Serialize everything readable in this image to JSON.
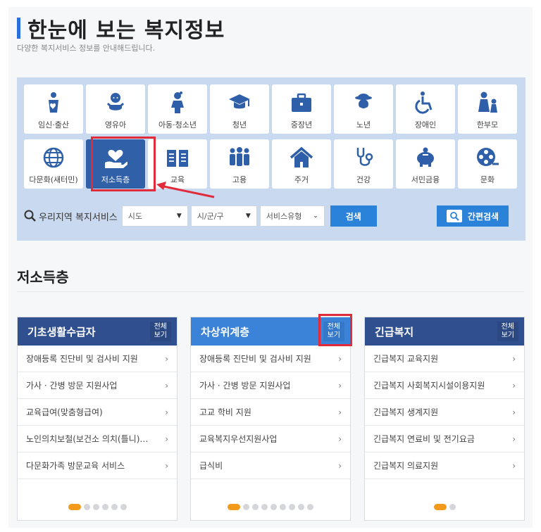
{
  "header": {
    "title": "한눈에 보는 복지정보",
    "subtitle": "다양한 복지서비스 정보를 안내해드립니다."
  },
  "categories": [
    {
      "label": "임신·출산",
      "icon": "pregnancy-icon"
    },
    {
      "label": "영유아",
      "icon": "infant-icon"
    },
    {
      "label": "아동·청소년",
      "icon": "child-icon"
    },
    {
      "label": "청년",
      "icon": "graduation-cap-icon"
    },
    {
      "label": "중장년",
      "icon": "briefcase-icon"
    },
    {
      "label": "노년",
      "icon": "elder-icon"
    },
    {
      "label": "장애인",
      "icon": "wheelchair-icon"
    },
    {
      "label": "한부모",
      "icon": "single-parent-icon"
    },
    {
      "label": "다문화(새터민)",
      "icon": "globe-icon"
    },
    {
      "label": "저소득층",
      "icon": "heart-hand-icon",
      "selected": true
    },
    {
      "label": "교육",
      "icon": "book-icon"
    },
    {
      "label": "고용",
      "icon": "people-icon"
    },
    {
      "label": "주거",
      "icon": "house-icon"
    },
    {
      "label": "건강",
      "icon": "stethoscope-icon"
    },
    {
      "label": "서민금융",
      "icon": "piggy-bank-icon"
    },
    {
      "label": "문화",
      "icon": "film-reel-icon"
    }
  ],
  "search": {
    "label": "우리지역 복지서비스",
    "sido": "시도",
    "sigungu": "시/군/구",
    "service_type": "서비스유형",
    "search_button": "검색",
    "quick_button": "간편검색"
  },
  "section": {
    "title": "저소득층"
  },
  "cards": [
    {
      "title": "기초생활수급자",
      "more": "전체 보기",
      "items": [
        "장애등록 진단비 및 검사비 지원",
        "가사 · 간병 방문 지원사업",
        "교육급여(맞춤형급여)",
        "노인의치보철(보건소 의치(틀니)…",
        "다문화가족 방문교육 서비스"
      ]
    },
    {
      "title": "차상위계층",
      "more": "전체 보기",
      "items": [
        "장애등록 진단비 및 검사비 지원",
        "가사 · 간병 방문 지원사업",
        "고교 학비 지원",
        "교육복지우선지원사업",
        "급식비"
      ]
    },
    {
      "title": "긴급복지",
      "more": "전체 보기",
      "items": [
        "긴급복지 교육지원",
        "긴급복지 사회복지시설이용지원",
        "긴급복지 생계지원",
        "긴급복지 연료비 및 전기요금",
        "긴급복지 의료지원"
      ]
    }
  ],
  "colors": {
    "accent": "#2b82d9",
    "selected_tile": "#2f60a8",
    "card1_head": "#2f4f8f",
    "card2_head": "#3b83d9",
    "card3_head": "#2f4f8f",
    "highlight": "#e02b3a",
    "dot_active": "#f39a1c"
  }
}
